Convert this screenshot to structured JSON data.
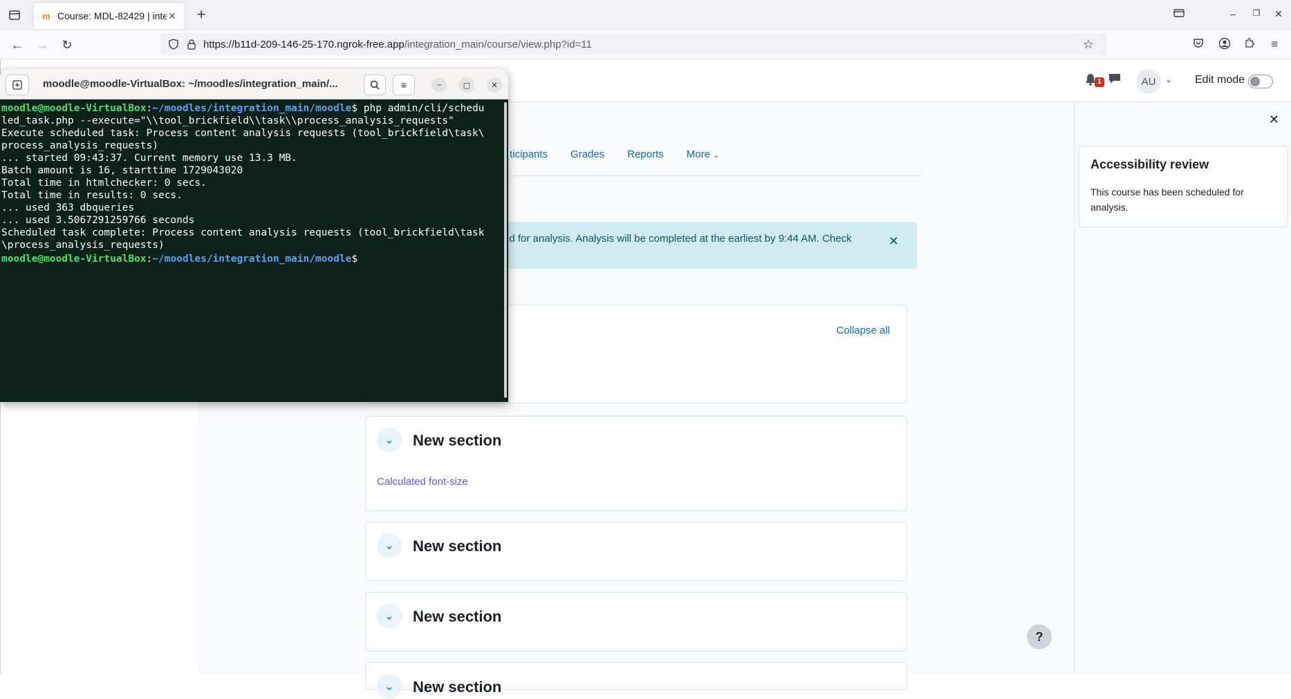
{
  "browser": {
    "tab": {
      "title": "Course: MDL-82429 | inte",
      "favicon": "moodle-favicon"
    },
    "url": {
      "host": "https://b11d-209-146-25-170.ngrok-free.app",
      "path": "/integration_main/course/view.php?id=11"
    }
  },
  "moodle": {
    "header": {
      "notification_count": "1",
      "avatar_initials": "AU",
      "edit_mode_label": "Edit mode",
      "edit_mode_on": false
    },
    "secondary_nav": [
      "ticipants",
      "Grades",
      "Reports",
      "More"
    ],
    "alert_text": "ed for analysis. Analysis will be completed at the earliest by 9:44 AM. Check",
    "collapse_all": "Collapse all",
    "sections": [
      {
        "title": "New section",
        "activity": "Calculated font-size"
      },
      {
        "title": "New section"
      },
      {
        "title": "New section"
      },
      {
        "title": "New section"
      }
    ],
    "drawer": {
      "heading": "Accessibility review",
      "body": "This course has been scheduled for analysis."
    },
    "help_label": "?"
  },
  "terminal": {
    "title": "moodle@moodle-VirtualBox: ~/moodles/integration_main/...",
    "prompt_user": "moodle@moodle-VirtualBox",
    "prompt_path": "~/moodles/integration_main/moodle",
    "command_1": " php admin/cli/schedu",
    "lines": [
      "led_task.php --execute=\"\\\\tool_brickfield\\\\task\\\\process_analysis_requests\"",
      "Execute scheduled task: Process content analysis requests (tool_brickfield\\task\\",
      "process_analysis_requests)",
      "... started 09:43:37. Current memory use 13.3 MB.",
      "Batch amount is 16, starttime 1729043020",
      "Total time in htmlchecker: 0 secs.",
      "Total time in results: 0 secs.",
      "... used 363 dbqueries",
      "... used 3.5067291259766 seconds",
      "Scheduled task complete: Process content analysis requests (tool_brickfield\\task",
      "\\process_analysis_requests)"
    ]
  }
}
